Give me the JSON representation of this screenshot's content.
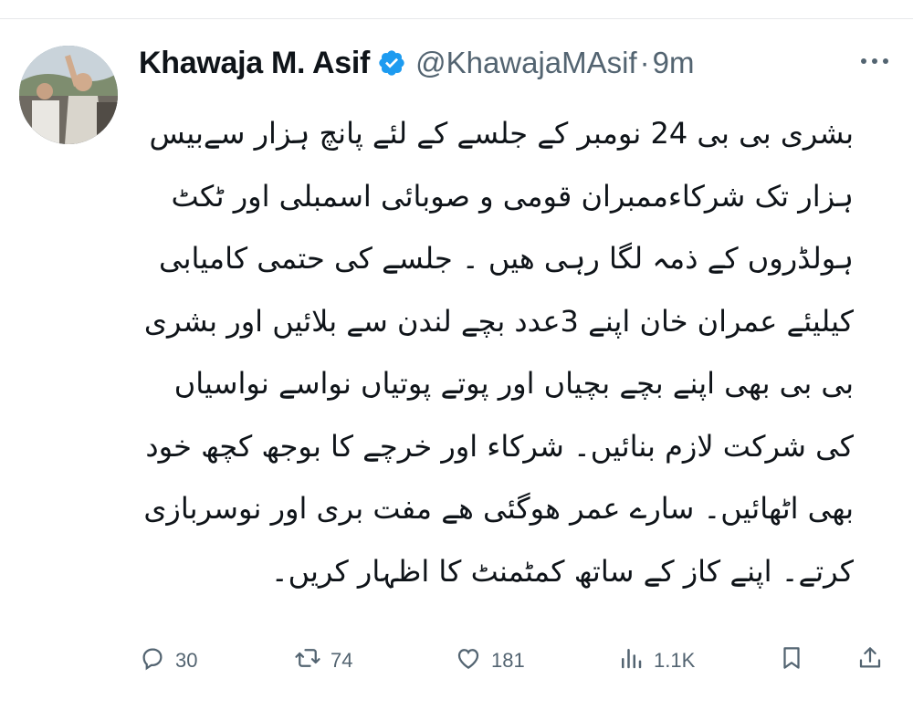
{
  "author": {
    "display_name": "Khawaja M. Asif",
    "handle": "@KhawajaMAsif",
    "separator": "·",
    "time": "9m"
  },
  "tweet": {
    "text": "بشری بی بی 24 نومبر کے جلسے کے لئے پانچ ہزار سےبیس ہزار تک شرکاءممبران قومی و صوبائی اسمبلی اور ٹکٹ ہولڈروں کے ذمہ لگا رہی ھیں ۔ جلسے کی حتمی کامیابی کیلیئے عمران خان اپنے 3عدد بچے لندن سے بلائیں اور بشری بی بی بھی اپنے بچے بچیاں اور پوتے پوتیاں نواسے نواسیاں کی شرکت لازم بنائیں۔ شرکاء اور خرچے کا بوجھ کچھ خود بھی اٹھائیں۔ سارے عمر ھوگئی ھے مفت بری اور نوسربازی کرتے۔ اپنے کاز کے ساتھ کمٹمنٹ کا اظہار کریں۔"
  },
  "actions": {
    "replies": "30",
    "retweets": "74",
    "likes": "181",
    "views": "1.1K"
  },
  "icons": {
    "verified": "verified-badge-icon",
    "more": "more-dots-icon",
    "reply": "reply-icon",
    "retweet": "retweet-icon",
    "like": "heart-icon",
    "views": "analytics-icon",
    "bookmark": "bookmark-icon",
    "share": "share-icon"
  },
  "colors": {
    "verified": "#1d9bf0",
    "secondary_text": "#536471",
    "primary_text": "#0f1419"
  }
}
